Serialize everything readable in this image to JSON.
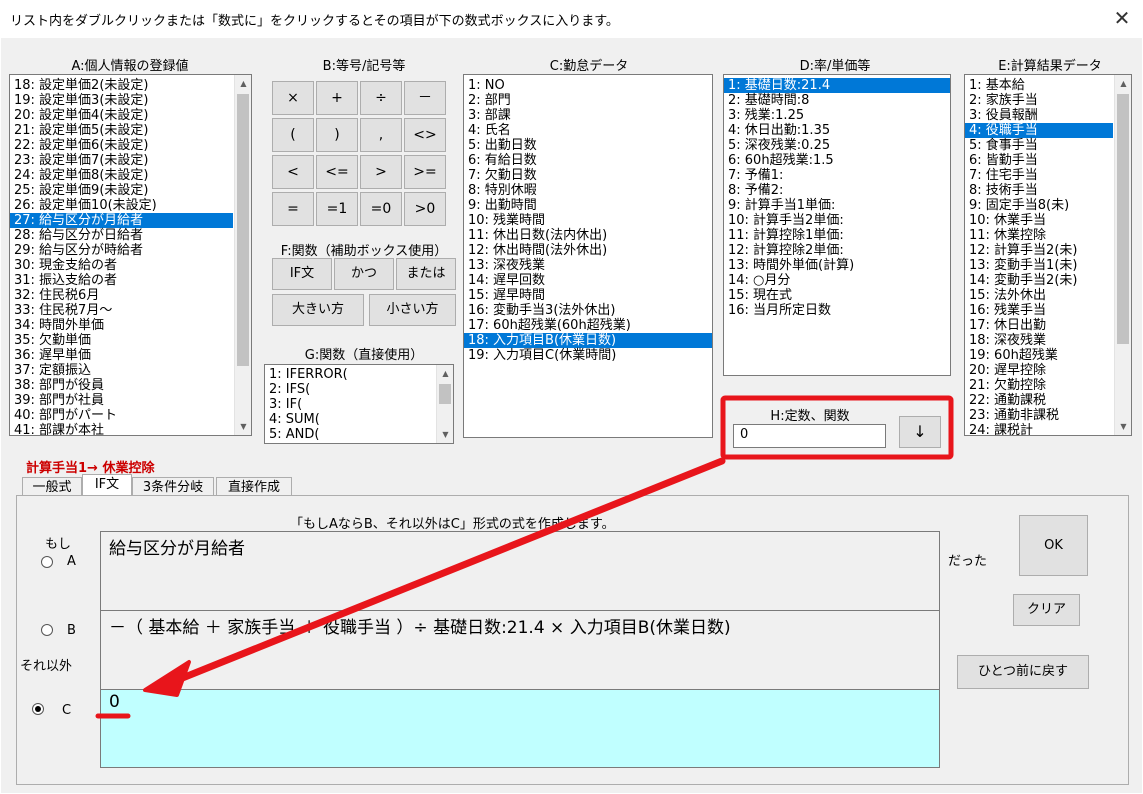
{
  "window": {
    "title": "リスト内をダブルクリックまたは「数式に」をクリックするとその項目が下の数式ボックスに入ります。",
    "close_label": "✕"
  },
  "colA": {
    "header": "A:個人情報の登録値",
    "items": [
      "18: 設定単価2(未設定)",
      "19: 設定単価3(未設定)",
      "20: 設定単価4(未設定)",
      "21: 設定単価5(未設定)",
      "22: 設定単価6(未設定)",
      "23: 設定単価7(未設定)",
      "24: 設定単価8(未設定)",
      "25: 設定単価9(未設定)",
      "26: 設定単価10(未設定)",
      "27: 給与区分が月給者",
      "28: 給与区分が日給者",
      "29: 給与区分が時給者",
      "30: 現金支給の者",
      "31: 振込支給の者",
      "32: 住民税6月",
      "33: 住民税7月～",
      "34: 時間外単価",
      "35: 欠勤単価",
      "36: 遅早単価",
      "37: 定額振込",
      "38: 部門が役員",
      "39: 部門が社員",
      "40: 部門がパート",
      "41: 部課が本社"
    ],
    "selected": "27: 給与区分が月給者"
  },
  "colB": {
    "header": "B:等号/記号等",
    "buttons": [
      "×",
      "+",
      "÷",
      "－",
      "(",
      ")",
      ",",
      "<>",
      "<",
      "<=",
      ">",
      ">=",
      "=",
      "=1",
      "=0",
      ">0"
    ]
  },
  "colF": {
    "header": "F:関数（補助ボックス使用）",
    "if_label": "IF文",
    "and_label": "かつ",
    "or_label": "または",
    "max_label": "大きい方",
    "min_label": "小さい方"
  },
  "colG": {
    "header": "G:関数（直接使用）",
    "items": [
      "1: IFERROR(",
      "2: IFS(",
      "3: IF(",
      "4: SUM(",
      "5: AND("
    ]
  },
  "colC": {
    "header": "C:勤怠データ",
    "items": [
      "1: NO",
      "2: 部門",
      "3: 部課",
      "4: 氏名",
      "5: 出勤日数",
      "6: 有給日数",
      "7: 欠勤日数",
      "8: 特別休暇",
      "9: 出勤時間",
      "10: 残業時間",
      "11: 休出日数(法内休出)",
      "12: 休出時間(法外休出)",
      "13: 深夜残業",
      "14: 遅早回数",
      "15: 遅早時間",
      "16: 変動手当3(法外休出)",
      "17: 60h超残業(60h超残業)",
      "18: 入力項目B(休業日数)",
      "19: 入力項目C(休業時間)"
    ],
    "selected": "18: 入力項目B(休業日数)"
  },
  "colD": {
    "header": "D:率/単価等",
    "items": [
      "1: 基礎日数:21.4",
      "2: 基礎時間:8",
      "3: 残業:1.25",
      "4: 休日出勤:1.35",
      "5: 深夜残業:0.25",
      "6: 60h超残業:1.5",
      "7: 予備1:",
      "8: 予備2:",
      "9: 計算手当1単価:",
      "10: 計算手当2単価:",
      "11: 計算控除1単価:",
      "12: 計算控除2単価:",
      "13: 時間外単価(計算)",
      "14: ○月分",
      "15: 現在式",
      "16: 当月所定日数"
    ],
    "selected": "1: 基礎日数:21.4"
  },
  "colH": {
    "header": "H:定数、関数",
    "value": "0",
    "insert_button": "↓"
  },
  "colE": {
    "header": "E:計算結果データ",
    "items": [
      "1: 基本給",
      "2: 家族手当",
      "3: 役員報酬",
      "4: 役職手当",
      "5: 食事手当",
      "6: 皆勤手当",
      "7: 住宅手当",
      "8: 技術手当",
      "9: 固定手当8(未)",
      "10: 休業手当",
      "11: 休業控除",
      "12: 計算手当2(未)",
      "13: 変動手当1(未)",
      "14: 変動手当2(未)",
      "15: 法外休出",
      "16: 残業手当",
      "17: 休日出勤",
      "18: 深夜残業",
      "19: 60h超残業",
      "20: 遅早控除",
      "21: 欠勤控除",
      "22: 通勤課税",
      "23: 通勤非課税",
      "24: 課税計"
    ],
    "selected": "4: 役職手当"
  },
  "target_label": "計算手当1→ 休業控除",
  "tabs": [
    "一般式",
    "IF文",
    "3条件分岐",
    "直接作成"
  ],
  "active_tab": "IF文",
  "if_panel": {
    "description": "「もしAならB、それ以外はC」形式の式を作成します。",
    "moshi_label": "もし",
    "radio_a_label": "A",
    "radio_b_label": "B",
    "soreigai_label": "それ以外",
    "radio_c_label": "C",
    "datta_label": "だった",
    "box_a": "給与区分が月給者",
    "box_b": "－（ 基本給 ＋ 家族手当 ＋ 役職手当 ）÷ 基礎日数:21.4 × 入力項目B(休業日数)",
    "box_c": "0",
    "selected_radio": "C",
    "ok_label": "OK",
    "clear_label": "クリア",
    "undo_label": "ひとつ前に戻す"
  },
  "colors": {
    "selection": "#0078d7",
    "annotation_red": "#e8151b",
    "target_label": "#cc0000",
    "box_c_bg": "#c0ffff"
  }
}
